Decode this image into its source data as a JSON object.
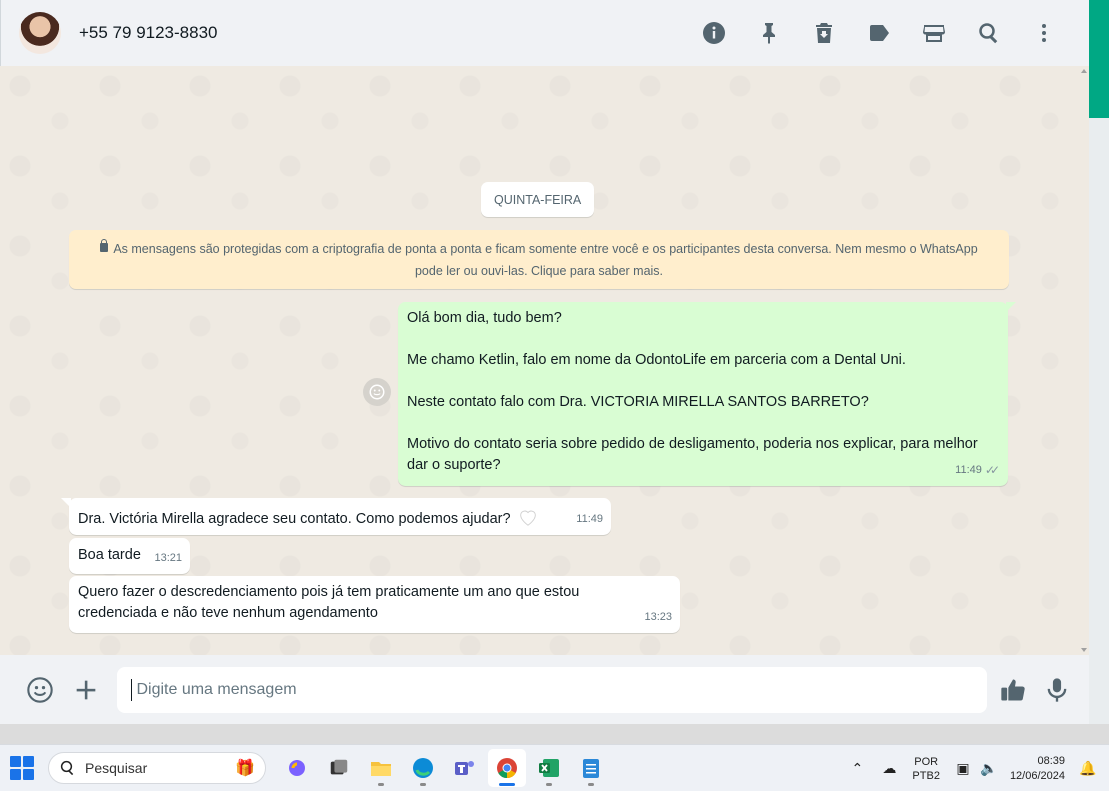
{
  "header": {
    "contact": "+55 79 9123-8830",
    "icons": [
      "info-icon",
      "pin-icon",
      "delete-icon",
      "label-icon",
      "store-icon",
      "search-icon",
      "menu-icon"
    ]
  },
  "chat": {
    "date_divider": "QUINTA-FEIRA",
    "encryption_notice": "As mensagens são protegidas com a criptografia de ponta a ponta e ficam somente entre você e os participantes desta conversa. Nem mesmo o WhatsApp pode ler ou ouvi-las. Clique para saber mais.",
    "outgoing": {
      "lines": [
        "Olá bom dia, tudo bem?",
        "Me chamo Ketlin, falo em nome da OdontoLife em parceria com a Dental Uni.",
        "Neste contato falo com Dra. VICTORIA MIRELLA SANTOS BARRETO?",
        "Motivo do contato seria sobre pedido de desligamento, poderia nos explicar, para melhor dar o suporte?"
      ],
      "time": "11:49",
      "ticks": "✓✓"
    },
    "incoming": [
      {
        "text": "Dra. Victória Mirella agradece seu contato. Como podemos ajudar?",
        "time": "11:49",
        "emoji": "heart-icon"
      },
      {
        "text": "Boa tarde",
        "time": "13:21"
      },
      {
        "text": "Quero fazer o descredenciamento pois já tem praticamente um ano que estou credenciada e não teve nenhum agendamento",
        "time": "13:23"
      }
    ]
  },
  "composer": {
    "placeholder": "Digite uma mensagem"
  },
  "taskbar": {
    "search_placeholder": "Pesquisar",
    "language": "POR",
    "layout": "PTB2",
    "time": "08:39",
    "date": "12/06/2024"
  },
  "colors": {
    "accent": "#00a884",
    "outgoing_bubble": "#d9fdd3",
    "incoming_bubble": "#ffffff",
    "chat_bg": "#efeae2",
    "notice_bg": "#ffeecd"
  }
}
